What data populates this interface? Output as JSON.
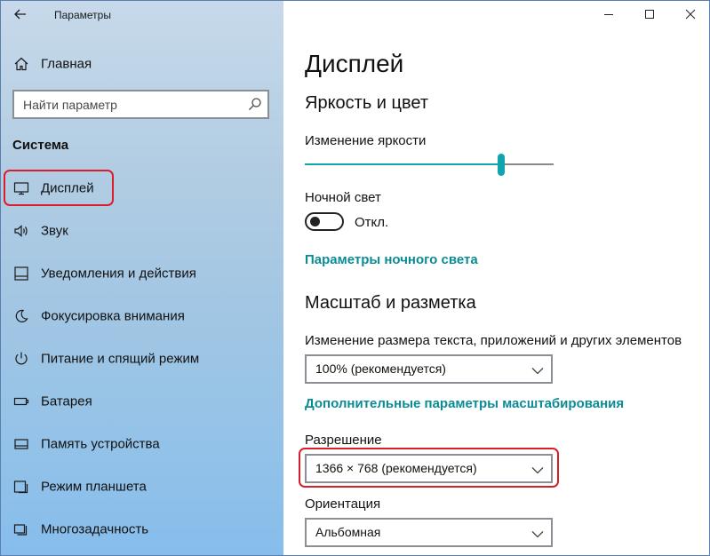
{
  "window": {
    "title": "Параметры"
  },
  "sidebar": {
    "home_label": "Главная",
    "search_placeholder": "Найти параметр",
    "section_header": "Система",
    "items": [
      {
        "label": "Дисплей",
        "icon": "monitor-icon"
      },
      {
        "label": "Звук",
        "icon": "speaker-icon"
      },
      {
        "label": "Уведомления и действия",
        "icon": "notification-icon"
      },
      {
        "label": "Фокусировка внимания",
        "icon": "moon-icon"
      },
      {
        "label": "Питание и спящий режим",
        "icon": "power-icon"
      },
      {
        "label": "Батарея",
        "icon": "battery-icon"
      },
      {
        "label": "Память устройства",
        "icon": "storage-icon"
      },
      {
        "label": "Режим планшета",
        "icon": "tablet-icon"
      },
      {
        "label": "Многозадачность",
        "icon": "multitask-icon"
      }
    ]
  },
  "content": {
    "page_title": "Дисплей",
    "brightness_section": "Яркость и цвет",
    "brightness_label": "Изменение яркости",
    "brightness_value": 0.79,
    "night_light_label": "Ночной свет",
    "night_light_state": "Откл.",
    "night_light_settings_link": "Параметры ночного света",
    "scale_section": "Масштаб и разметка",
    "scale_label": "Изменение размера текста, приложений и других элементов",
    "scale_value": "100% (рекомендуется)",
    "advanced_scale_link": "Дополнительные параметры масштабирования",
    "resolution_label": "Разрешение",
    "resolution_value": "1366 × 768 (рекомендуется)",
    "orientation_label": "Ориентация",
    "orientation_value": "Альбомная"
  },
  "colors": {
    "accent": "#10a5ae",
    "link": "#0a8c94",
    "highlight": "#d81e2a"
  }
}
